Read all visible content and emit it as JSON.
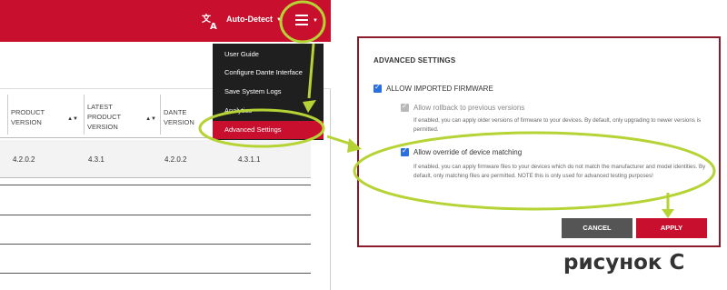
{
  "header": {
    "language_label": "Auto-Detect"
  },
  "menu": {
    "items": [
      "User Guide",
      "Configure Dante Interface",
      "Save System Logs",
      "Analytics",
      "Advanced Settings"
    ]
  },
  "table": {
    "columns": [
      {
        "label": "PRODUCT\nVERSION"
      },
      {
        "label": "LATEST\nPRODUCT\nVERSION"
      },
      {
        "label": "DANTE\nVERSION"
      }
    ],
    "row": [
      "4.2.0.2",
      "4.3.1",
      "4.2.0.2",
      "4.3.1.1"
    ]
  },
  "dialog": {
    "title": "ADVANCED SETTINGS",
    "allow_imported_firmware": "ALLOW IMPORTED FIRMWARE",
    "allow_rollback": "Allow rollback to previous versions",
    "rollback_desc": "If enabled, you can apply older versions of firmware to your devices. By default, only upgrading to newer versions is permitted.",
    "allow_override": "Allow override of device matching",
    "override_desc": "If enabled, you can apply firmware files to your devices which do not match the manufacturer and model identities. By default, only matching files are permitted. NOTE this is only used for advanced testing purposes!",
    "cancel_label": "CANCEL",
    "apply_label": "APPLY"
  },
  "caption": "рисунок С",
  "colors": {
    "brand_red": "#c8102e",
    "annotation_green": "#b5d334",
    "checkbox_blue": "#2a6ee0"
  }
}
